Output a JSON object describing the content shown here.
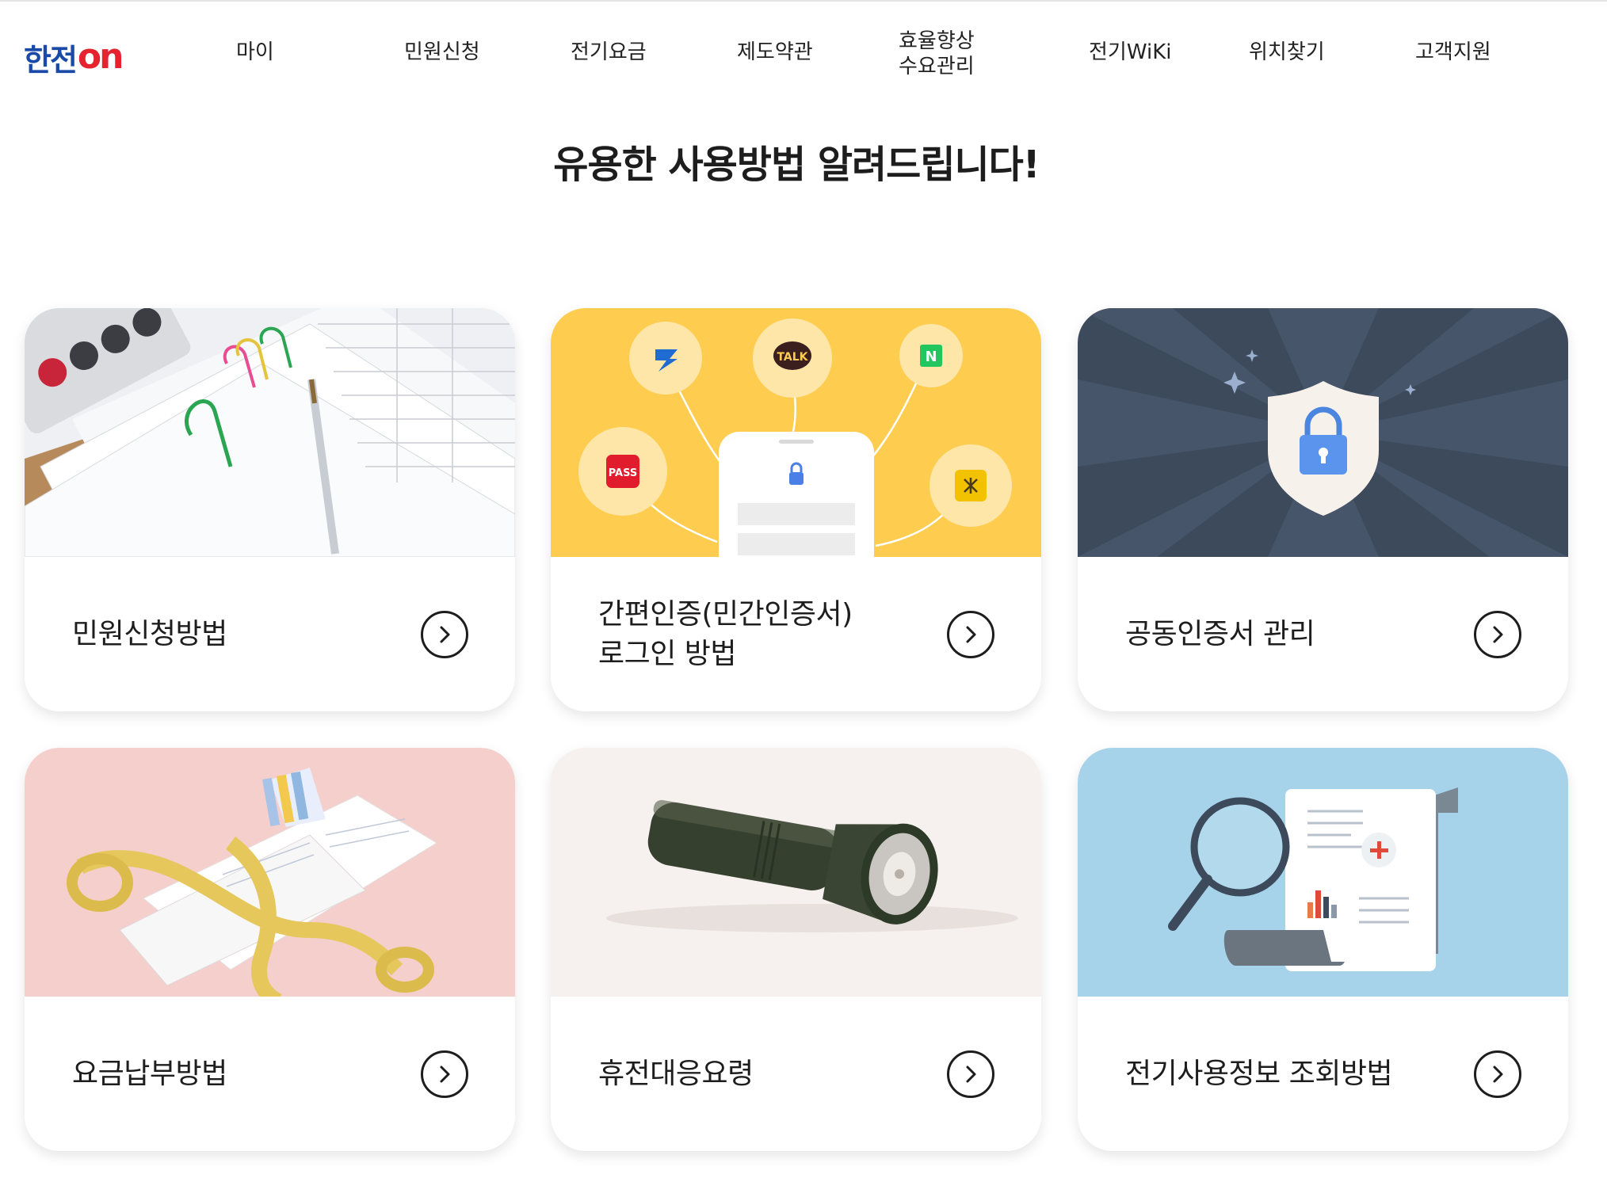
{
  "header": {
    "logo_text": "한전",
    "logo_on": "on",
    "nav": [
      {
        "label": "마이"
      },
      {
        "label": "민원신청"
      },
      {
        "label": "전기요금"
      },
      {
        "label": "제도약관"
      },
      {
        "label": "효율향상\n수요관리"
      },
      {
        "label": "전기WiKi"
      },
      {
        "label": "위치찾기"
      },
      {
        "label": "고객지원"
      }
    ]
  },
  "main": {
    "title": "유용한 사용방법 알려드립니다!",
    "cards": [
      {
        "label": "민원신청방법",
        "image": "documents-calculator-photo"
      },
      {
        "label": "간편인증(민간인증서)\n로그인 방법",
        "image": "simple-auth-illustration",
        "badges": [
          "TALK",
          "N",
          "PASS"
        ]
      },
      {
        "label": "공동인증서 관리",
        "image": "security-shield-illustration"
      },
      {
        "label": "요금납부방법",
        "image": "bills-tape-measure-photo"
      },
      {
        "label": "휴전대응요령",
        "image": "flashlight-photo"
      },
      {
        "label": "전기사용정보 조회방법",
        "image": "magnifier-report-illustration"
      }
    ]
  },
  "colors": {
    "logo_blue": "#1a4aa8",
    "logo_red": "#e5222d",
    "auth_bg": "#fecd50",
    "shield_bg": "#3d4a5c",
    "pink_bg": "#f4cfcb",
    "blue_bg": "#a6d3ea"
  }
}
